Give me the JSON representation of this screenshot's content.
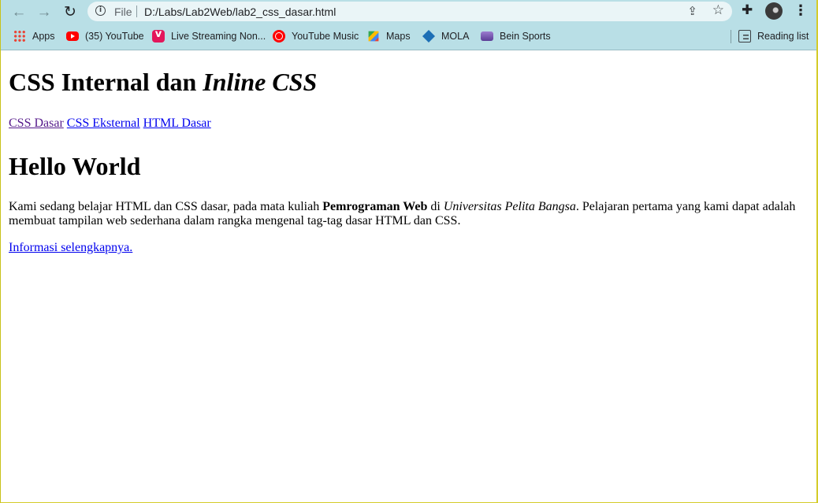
{
  "browser": {
    "omnibox": {
      "scheme_label": "File",
      "url": "D:/Labs/Lab2Web/lab2_css_dasar.html"
    },
    "bookmarks": [
      {
        "label": "Apps",
        "icon": "apps-grid-icon"
      },
      {
        "label": "(35) YouTube",
        "icon": "youtube-icon"
      },
      {
        "label": "Live Streaming Non...",
        "icon": "vidio-icon"
      },
      {
        "label": "YouTube Music",
        "icon": "youtube-music-icon"
      },
      {
        "label": "Maps",
        "icon": "maps-icon"
      },
      {
        "label": "MOLA",
        "icon": "mola-icon"
      },
      {
        "label": "Bein Sports",
        "icon": "bein-sports-icon"
      }
    ],
    "reading_list_label": "Reading list",
    "chrome_color": "#b9dfe6"
  },
  "page": {
    "title_main": "CSS Internal dan ",
    "title_italic": "Inline CSS",
    "nav_links": [
      {
        "label": "CSS Dasar",
        "visited": true
      },
      {
        "label": "CSS Eksternal",
        "visited": false
      },
      {
        "label": "HTML Dasar",
        "visited": false
      }
    ],
    "heading": "Hello World",
    "intro": {
      "part1": "Kami sedang belajar HTML dan CSS dasar, pada mata kuliah ",
      "bold": "Pemrograman Web",
      "part2": " di ",
      "italic": "Universitas Pelita Bangsa",
      "part3": ". Pelajaran pertama yang kami dapat adalah membuat tampilan web sederhana dalam rangka mengenal tag-tag dasar HTML dan CSS."
    },
    "more_link": "Informasi selengkapnya.",
    "link_color": "#0000ee",
    "visited_link_color": "#551a8b"
  }
}
